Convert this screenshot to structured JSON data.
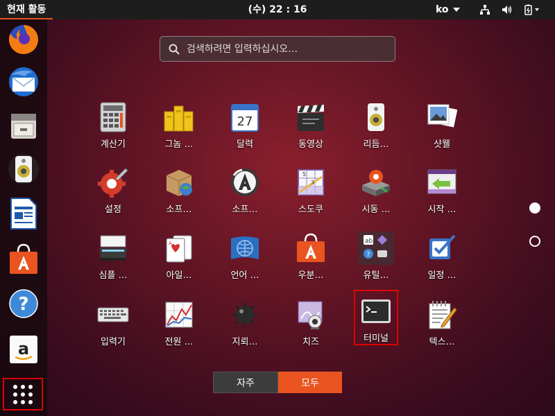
{
  "topbar": {
    "activities": "현재 활동",
    "clock": "(수) 22 : 16",
    "lang": "ko",
    "tray_icons": [
      "network-icon",
      "volume-icon",
      "power-icon"
    ]
  },
  "dock": {
    "items": [
      "firefox",
      "thunderbird",
      "files",
      "rhythmbox",
      "libreoffice-writer",
      "ubuntu-software",
      "help",
      "amazon"
    ],
    "show_apps_icon": "grid-icon"
  },
  "search": {
    "placeholder": "검색하려면 입력하십시오…"
  },
  "apps": [
    {
      "label": "계산기",
      "icon": "calculator-icon"
    },
    {
      "label": "그놈 …",
      "icon": "gnome-games-icon"
    },
    {
      "label": "달력",
      "icon": "calendar-icon",
      "day": "27"
    },
    {
      "label": "동영상",
      "icon": "video-clapper-icon"
    },
    {
      "label": "리듬…",
      "icon": "speaker-icon"
    },
    {
      "label": "샷웰",
      "icon": "photos-icon"
    },
    {
      "label": "설정",
      "icon": "settings-gear-icon"
    },
    {
      "label": "소프…",
      "icon": "package-box-icon"
    },
    {
      "label": "소프…",
      "icon": "software-updater-icon"
    },
    {
      "label": "스도쿠",
      "icon": "sudoku-icon"
    },
    {
      "label": "시동 …",
      "icon": "startup-disk-icon"
    },
    {
      "label": "시작 …",
      "icon": "startup-apps-icon"
    },
    {
      "label": "심플 …",
      "icon": "scanner-icon"
    },
    {
      "label": "아일…",
      "icon": "cards-icon"
    },
    {
      "label": "언어 …",
      "icon": "language-icon"
    },
    {
      "label": "우분…",
      "icon": "ubuntu-software-icon"
    },
    {
      "label": "유틸…",
      "icon": "utilities-folder-icon"
    },
    {
      "label": "일정 …",
      "icon": "todo-check-icon"
    },
    {
      "label": "입력기",
      "icon": "keyboard-icon"
    },
    {
      "label": "전원 …",
      "icon": "power-stats-icon"
    },
    {
      "label": "지뢰…",
      "icon": "mine-icon"
    },
    {
      "label": "치즈",
      "icon": "webcam-icon"
    },
    {
      "label": "터미널",
      "icon": "terminal-icon",
      "selected": true
    },
    {
      "label": "텍스…",
      "icon": "text-editor-icon"
    }
  ],
  "pages": {
    "count": 2,
    "current": 1
  },
  "view_switch": {
    "frequent": "자주",
    "all": "모두",
    "active": "all"
  },
  "colors": {
    "accent": "#e95420",
    "selection": "#e00000"
  }
}
